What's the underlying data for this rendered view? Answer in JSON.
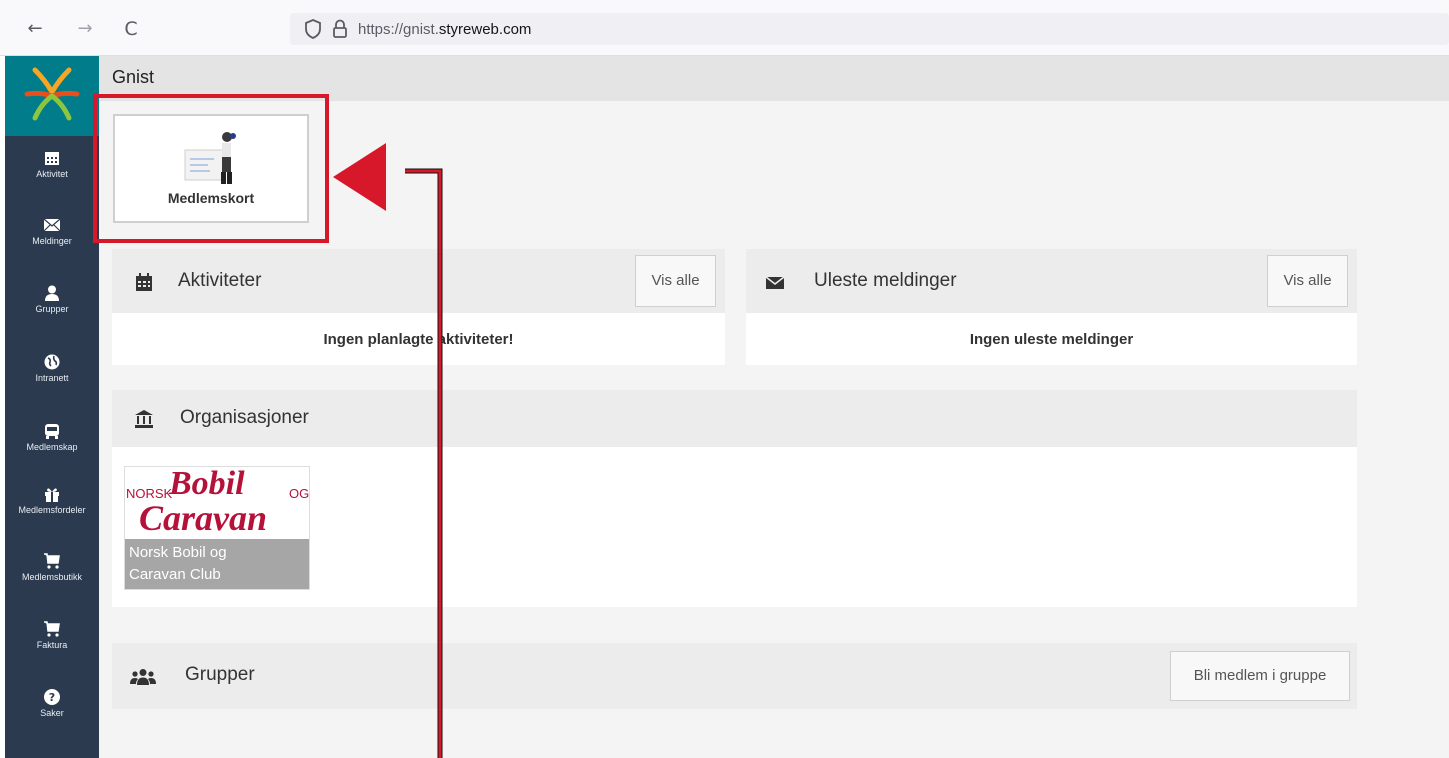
{
  "browser": {
    "back": "←",
    "forward": "→",
    "reload": "C",
    "url_prefix": "https://gnist.",
    "url_domain": "styreweb.com"
  },
  "sidebar": {
    "items": [
      {
        "label": "Aktivitet",
        "icon": "calendar-icon"
      },
      {
        "label": "Meldinger",
        "icon": "envelope-icon"
      },
      {
        "label": "Grupper",
        "icon": "user-icon"
      },
      {
        "label": "Intranett",
        "icon": "globe-icon"
      },
      {
        "label": "Medlemskap",
        "icon": "bus-icon"
      },
      {
        "label": "Medlemsfordeler",
        "icon": "gift-icon"
      },
      {
        "label": "Medlemsbutikk",
        "icon": "cart-icon"
      },
      {
        "label": "Faktura",
        "icon": "cart-icon"
      },
      {
        "label": "Saker",
        "icon": "question-icon"
      }
    ]
  },
  "header": {
    "title": "Gnist"
  },
  "medlemskort": {
    "label": "Medlemskort"
  },
  "aktiviteter": {
    "title": "Aktiviteter",
    "button": "Vis alle",
    "empty": "Ingen planlagte aktiviteter!"
  },
  "meldinger": {
    "title": "Uleste meldinger",
    "button": "Vis alle",
    "empty": "Ingen uleste meldinger"
  },
  "organisasjoner": {
    "title": "Organisasjoner",
    "org": {
      "logo_small": "NORSK",
      "logo_word1": "Bobil",
      "logo_small2": "OG",
      "logo_word2": "Caravan",
      "name_line1": "Norsk Bobil og",
      "name_line2": "Caravan Club"
    }
  },
  "grupper": {
    "title": "Grupper",
    "button": "Bli medlem i gruppe"
  },
  "colors": {
    "sidebar": "#2b3a4f",
    "logo_bg": "#007c8a",
    "highlight": "#d7182a",
    "org_red": "#b5123a"
  }
}
